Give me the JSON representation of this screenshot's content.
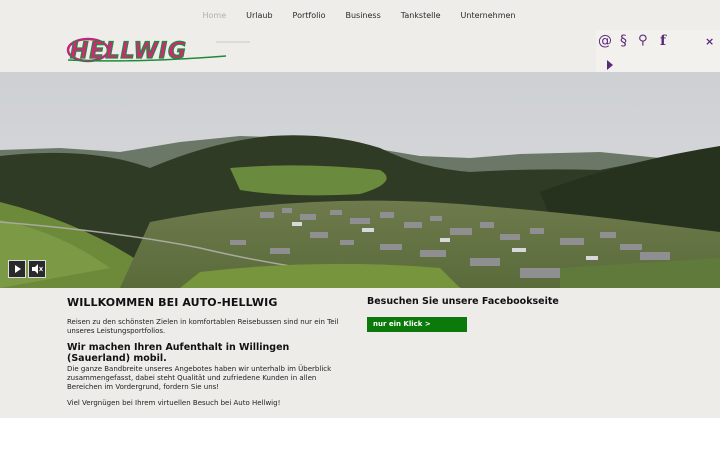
{
  "nav": {
    "items": [
      {
        "label": "Home",
        "active": true
      },
      {
        "label": "Urlaub",
        "active": false
      },
      {
        "label": "Portfolio",
        "active": false
      },
      {
        "label": "Business",
        "active": false
      },
      {
        "label": "Tankstelle",
        "active": false
      },
      {
        "label": "Unternehmen",
        "active": false
      }
    ]
  },
  "logo": {
    "text": "HELLWIG"
  },
  "social": {
    "email_icon": "@",
    "imprint_icon": "§",
    "key_icon": "⚲",
    "facebook_icon": "f",
    "close_icon": "×",
    "expand_icon": "play-triangle-icon",
    "accent_color": "#5a2a7a"
  },
  "hero": {
    "play_icon": "play-icon",
    "mute_icon": "mute-icon"
  },
  "main": {
    "welcome_title": "WILLKOMMEN BEI AUTO-HELLWIG",
    "intro_text": "Reisen zu den schönsten Zielen in komfortablen Reisebussen sind nur ein Teil unseres Leistungsportfolios.",
    "subheading": "Wir machen Ihren Aufenthalt in Willingen (Sauerland) mobil.",
    "body_text": "Die ganze Bandbreite unseres Angebotes haben wir unterhalb im Überblick zusammengefasst, dabei steht Qualität und zufriedene Kunden in allen Bereichen im Vordergrund, fordern Sie uns!",
    "closing_text": "Viel Vergnügen bei Ihrem virtuellen Besuch bei Auto Hellwig!"
  },
  "facebook": {
    "title": "Besuchen Sie unsere Facebookseite",
    "button_label": "nur ein Klick >",
    "button_color": "#0b7a0b"
  }
}
